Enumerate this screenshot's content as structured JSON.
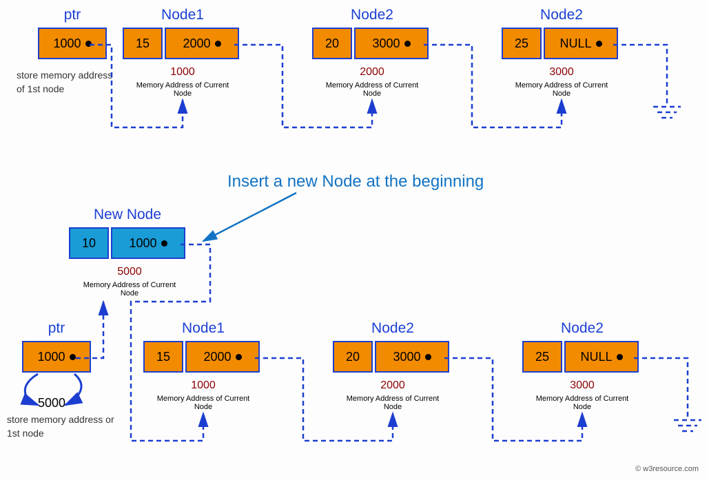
{
  "top": {
    "ptr": {
      "title": "ptr",
      "value": "1000",
      "desc": "store memory address of 1st node"
    },
    "nodes": [
      {
        "title": "Node1",
        "data": "15",
        "next": "2000",
        "addr": "1000",
        "caption": "Memory Address of Current Node"
      },
      {
        "title": "Node2",
        "data": "20",
        "next": "3000",
        "addr": "2000",
        "caption": "Memory Address of Current Node"
      },
      {
        "title": "Node2",
        "data": "25",
        "next": "NULL",
        "addr": "3000",
        "caption": "Memory Address of Current Node"
      }
    ]
  },
  "insert_title": "Insert a new Node at the beginning",
  "new_node": {
    "title": "New Node",
    "data": "10",
    "next": "1000",
    "addr": "5000",
    "caption": "Memory Address of Current Node"
  },
  "bottom": {
    "ptr": {
      "title": "ptr",
      "value": "1000",
      "replacement": "5000",
      "desc": "store memory address or 1st node"
    },
    "nodes": [
      {
        "title": "Node1",
        "data": "15",
        "next": "2000",
        "addr": "1000",
        "caption": "Memory Address of Current Node"
      },
      {
        "title": "Node2",
        "data": "20",
        "next": "3000",
        "addr": "2000",
        "caption": "Memory Address of Current Node"
      },
      {
        "title": "Node2",
        "data": "25",
        "next": "NULL",
        "addr": "3000",
        "caption": "Memory Address of Current Node"
      }
    ]
  },
  "footer": "© w3resource.com",
  "chart_data": {
    "type": "diagram",
    "concept": "singly_linked_list_insert_at_beginning",
    "before": {
      "head_ptr_address": 1000,
      "nodes": [
        {
          "address": 1000,
          "data": 15,
          "next": 2000
        },
        {
          "address": 2000,
          "data": 20,
          "next": 3000
        },
        {
          "address": 3000,
          "data": 25,
          "next": null
        }
      ]
    },
    "operation": {
      "label": "Insert a new Node at the beginning",
      "new_node": {
        "address": 5000,
        "data": 10,
        "next": 1000
      }
    },
    "after": {
      "head_ptr_address_old": 1000,
      "head_ptr_address_new": 5000,
      "nodes": [
        {
          "address": 5000,
          "data": 10,
          "next": 1000
        },
        {
          "address": 1000,
          "data": 15,
          "next": 2000
        },
        {
          "address": 2000,
          "data": 20,
          "next": 3000
        },
        {
          "address": 3000,
          "data": 25,
          "next": null
        }
      ]
    }
  }
}
